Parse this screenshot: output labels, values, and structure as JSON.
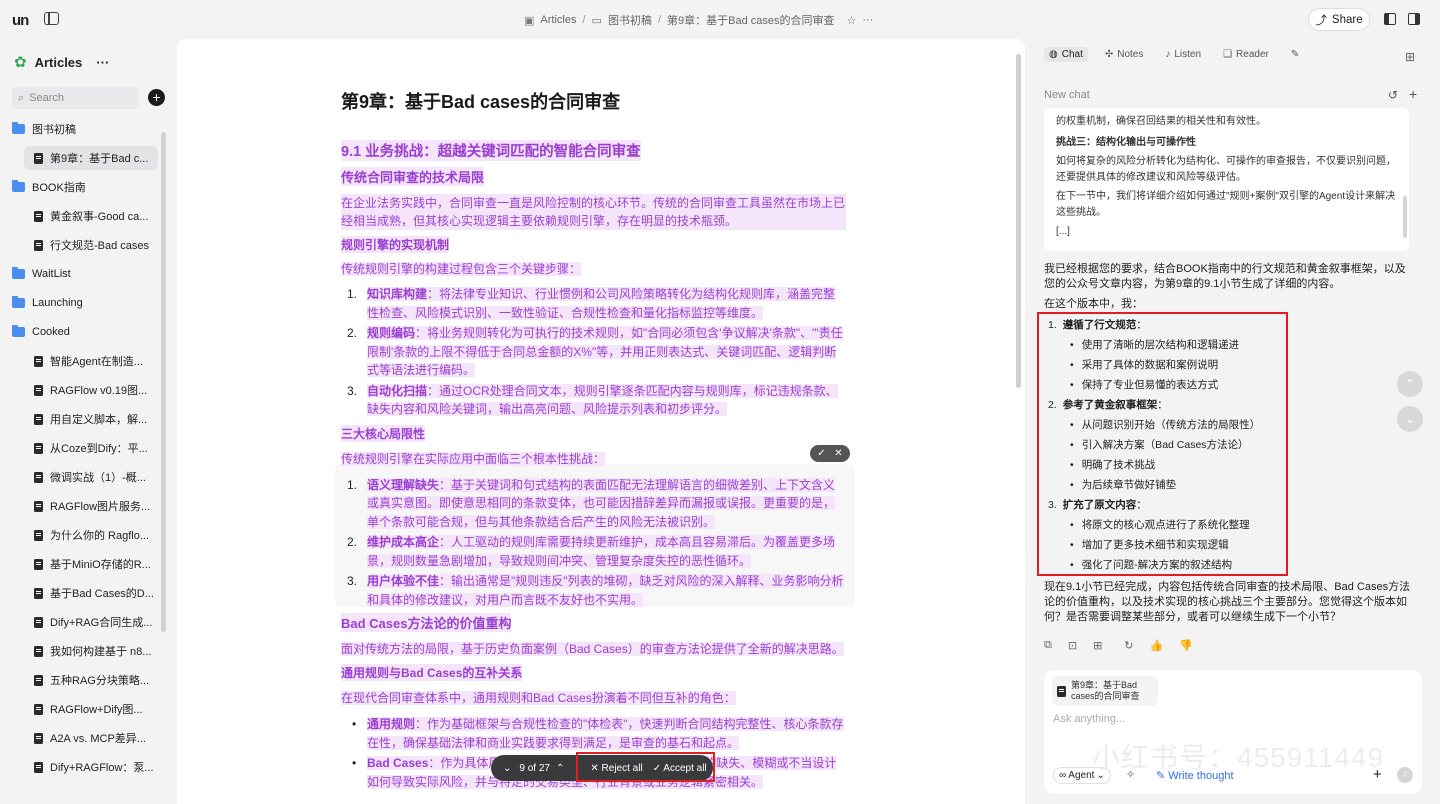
{
  "app": {
    "logo": "un",
    "search_placeholder": "Search"
  },
  "breadcrumb": {
    "root": "Articles",
    "folder": "图书初稿",
    "doc": "第9章：基于Bad cases的合同审查",
    "share": "Share"
  },
  "sidebar": {
    "title": "Articles",
    "items": [
      {
        "type": "folder",
        "label": "图书初稿"
      },
      {
        "type": "doc",
        "label": "第9章：基于Bad c...",
        "active": true
      },
      {
        "type": "folder",
        "label": "BOOK指南"
      },
      {
        "type": "doc",
        "label": "黄金叙事-Good ca..."
      },
      {
        "type": "doc",
        "label": "行文规范-Bad cases"
      },
      {
        "type": "folder",
        "label": "WaitList"
      },
      {
        "type": "folder",
        "label": "Launching"
      },
      {
        "type": "folder",
        "label": "Cooked"
      },
      {
        "type": "doc",
        "label": "智能Agent在制造..."
      },
      {
        "type": "doc",
        "label": "RAGFlow v0.19图..."
      },
      {
        "type": "doc",
        "label": "用自定义脚本，解..."
      },
      {
        "type": "doc",
        "label": "从Coze到Dify：平..."
      },
      {
        "type": "doc",
        "label": "微调实战（1）-概..."
      },
      {
        "type": "doc",
        "label": "RAGFlow图片服务..."
      },
      {
        "type": "doc",
        "label": "为什么你的 Ragflo..."
      },
      {
        "type": "doc",
        "label": "基于MiniO存储的R..."
      },
      {
        "type": "doc",
        "label": "基于Bad Cases的D..."
      },
      {
        "type": "doc",
        "label": "Dify+RAG合同生成..."
      },
      {
        "type": "doc",
        "label": "我如何构建基于 n8..."
      },
      {
        "type": "doc",
        "label": "五种RAG分块策略..."
      },
      {
        "type": "doc",
        "label": "RAGFlow+Dify图..."
      },
      {
        "type": "doc",
        "label": "A2A vs. MCP差异..."
      },
      {
        "type": "doc",
        "label": "Dify+RAGFlow：泵..."
      }
    ]
  },
  "doc": {
    "title": "第9章：基于Bad cases的合同审查",
    "h2_1": "9.1 业务挑战：超越关键词匹配的智能合同审查",
    "h3_1": "传统合同审查的技术局限",
    "p1": "在企业法务实践中，合同审查一直是风险控制的核心环节。传统的合同审查工具虽然在市场上已经相当成熟，但其核心实现逻辑主要依赖规则引擎，存在明显的技术瓶颈。",
    "h4_1": "规则引擎的实现机制",
    "p2": "传统规则引擎的构建过程包含三个关键步骤：",
    "steps": [
      {
        "n": "1.",
        "b": "知识库构建",
        "t": "：将法律专业知识、行业惯例和公司风险策略转化为结构化规则库，涵盖完整性检查、风险模式识别、一致性验证、合规性检查和量化指标监控等维度。"
      },
      {
        "n": "2.",
        "b": "规则编码",
        "t": "：将业务规则转化为可执行的技术规则，如\"合同必须包含'争议解决'条款\"、\"'责任限制'条款的上限不得低于合同总金额的X%\"等，并用正则表达式、关键词匹配、逻辑判断式等语法进行编码。"
      },
      {
        "n": "3.",
        "b": "自动化扫描",
        "t": "：通过OCR处理合同文本，规则引擎逐条匹配内容与规则库，标记违规条款、缺失内容和风险关键词，输出高亮问题、风险提示列表和初步评分。"
      }
    ],
    "h4_2": "三大核心局限性",
    "p3": "传统规则引擎在实际应用中面临三个根本性挑战：",
    "limits": [
      {
        "n": "1.",
        "b": "语义理解缺失",
        "t": "：基于关键词和句式结构的表面匹配无法理解语言的细微差别、上下文含义或真实意图。即使意思相同的条款变体，也可能因措辞差异而漏报或误报。更重要的是，单个条款可能合规，但与其他条款结合后产生的风险无法被识别。"
      },
      {
        "n": "2.",
        "b": "维护成本高企",
        "t": "：人工驱动的规则库需要持续更新维护，成本高且容易滞后。为覆盖更多场景，规则数量急剧增加，导致规则间冲突、管理复杂度失控的恶性循环。"
      },
      {
        "n": "3.",
        "b": "用户体验不佳",
        "t": "：输出通常是\"规则违反\"列表的堆砌，缺乏对风险的深入解释、业务影响分析和具体的修改建议，对用户而言既不友好也不实用。"
      }
    ],
    "h3_2": "Bad Cases方法论的价值重构",
    "p4": "面对传统方法的局限，基于历史负面案例（Bad Cases）的审查方法论提供了全新的解决思路。",
    "h4_3": "通用规则与Bad Cases的互补关系",
    "p5": "在现代合同审查体系中，通用规则和Bad Cases扮演着不同但互补的角色：",
    "roles": [
      {
        "b": "通用规则",
        "t": "：作为基础框架与合规性检查的\"体检表\"，快速判断合同结构完整性、核心条款存在性，确保基础法律和商业实践要求得到满足，是审查的基石和起点。"
      },
      {
        "b": "Bad Cases",
        "t": "：作为具体风险的识别器，能够发现合同中某些条款的缺失、模糊或不当设计如何导致实际风险，并与特定的交易类型、行业背景或业务逻辑紧密相关。"
      }
    ],
    "pager": {
      "count": "9 of 27",
      "reject": "Reject all",
      "accept": "Accept all"
    }
  },
  "chat": {
    "tabs": [
      "Chat",
      "Notes",
      "Listen",
      "Reader"
    ],
    "new_chat": "New chat",
    "card": {
      "l1": "的权重机制，确保召回结果的相关性和有效性。",
      "h": "挑战三：结构化输出与可操作性",
      "l2": "如何将复杂的风险分析转化为结构化、可操作的审查报告，不仅要识别问题，还要提供具体的修改建议和风险等级评估。",
      "l3": "在下一节中，我们将详细介绍如何通过\"规则+案例\"双引擎的Agent设计来解决这些挑战。",
      "l4": "[...]"
    },
    "reply": "我已经根据您的要求，结合BOOK指南中的行文规范和黄金叙事框架，以及您的公众号文章内容，为第9章的9.1小节生成了详细的内容。",
    "reply2": "在这个版本中，我：",
    "points": [
      {
        "n": "1.",
        "b": "遵循了行文规范",
        "subs": [
          "使用了清晰的层次结构和逻辑递进",
          "采用了具体的数据和案例说明",
          "保持了专业但易懂的表达方式"
        ]
      },
      {
        "n": "2.",
        "b": "参考了黄金叙事框架",
        "subs": [
          "从问题识别开始（传统方法的局限性）",
          "引入解决方案（Bad Cases方法论）",
          "明确了技术挑战",
          "为后续章节做好铺垫"
        ]
      },
      {
        "n": "3.",
        "b": "扩充了原文内容",
        "subs": [
          "将原文的核心观点进行了系统化整理",
          "增加了更多技术细节和实现逻辑",
          "强化了问题-解决方案的叙述结构"
        ]
      }
    ],
    "after": "现在9.1小节已经完成，内容包括传统合同审查的技术局限、Bad Cases方法论的价值重构，以及技术实现的核心挑战三个主要部分。您觉得这个版本如何？是否需要调整某些部分，或者可以继续生成下一个小节？",
    "input": {
      "chip": "第9章：基于Bad cases的合同审查",
      "placeholder": "Ask anything...",
      "agent": "Agent",
      "write": "Write thought"
    },
    "watermark": "小红书号：455911449"
  }
}
